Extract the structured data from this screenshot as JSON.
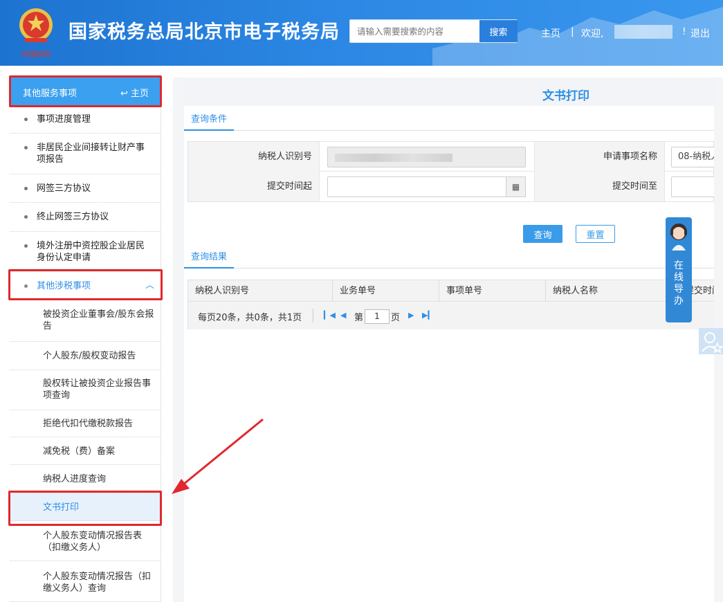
{
  "header": {
    "site_title": "国家税务总局北京市电子税务局",
    "search_placeholder": "请输入需要搜索的内容",
    "search_button": "搜索",
    "home_link": "主页",
    "separator": "|",
    "welcome": "欢迎,",
    "logout_sep": "!",
    "logout": "退出",
    "emblem_text": "中国税务"
  },
  "sidebar": {
    "header_label": "其他服务事项",
    "header_home": "主页",
    "items": [
      {
        "label": "事项进度管理"
      },
      {
        "label": "非居民企业间接转让财产事项报告"
      },
      {
        "label": "网签三方协议"
      },
      {
        "label": "终止网签三方协议"
      },
      {
        "label": "境外注册中资控股企业居民身份认定申请"
      },
      {
        "label": "其他涉税事项"
      }
    ],
    "subitems": [
      {
        "label": "被投资企业董事会/股东会报告"
      },
      {
        "label": "个人股东/股权变动报告"
      },
      {
        "label": "股权转让被投资企业报告事项查询"
      },
      {
        "label": "拒绝代扣代缴税款报告"
      },
      {
        "label": "减免税（费）备案"
      },
      {
        "label": "纳税人进度查询"
      },
      {
        "label": "文书打印"
      },
      {
        "label": "个人股东变动情况报告表（扣缴义务人）"
      },
      {
        "label": "个人股东变动情况报告（扣缴义务人）查询"
      }
    ]
  },
  "main": {
    "title": "文书打印",
    "query_tab": "查询条件",
    "result_tab": "查询结果",
    "fields": {
      "taxpayer_id_label": "纳税人识别号",
      "apply_item_label": "申请事项名称",
      "apply_item_value": "08-纳税人",
      "submit_from_label": "提交时间起",
      "submit_to_label": "提交时间至"
    },
    "buttons": {
      "query": "查询",
      "reset": "重置"
    },
    "table": {
      "columns": [
        "纳税人识别号",
        "业务单号",
        "事项单号",
        "纳税人名称",
        "提交时间"
      ]
    },
    "pager": {
      "summary": "每页20条，共0条，共1页",
      "page_prefix": "第",
      "page_value": "1",
      "page_suffix": "页"
    }
  },
  "guide": {
    "text": "在线导办"
  },
  "colors": {
    "header_blue": "#2b87e3",
    "accent": "#2d8fe6",
    "highlight": "#e0282e"
  }
}
